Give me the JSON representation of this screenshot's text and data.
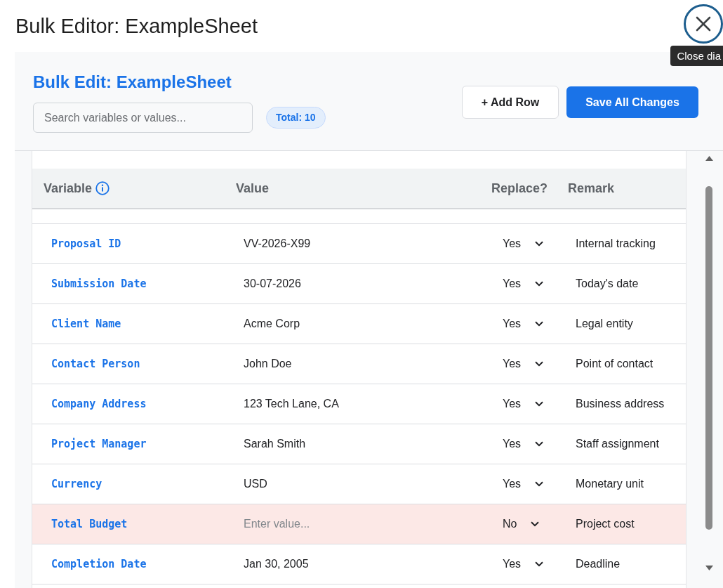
{
  "dialog": {
    "title": "Bulk Editor: ExampleSheet",
    "close_tooltip": "Close dia"
  },
  "panel": {
    "heading": "Bulk Edit: ExampleSheet",
    "search": {
      "placeholder": "Search variables or values..."
    },
    "total_badge": "Total: 10",
    "buttons": [
      {
        "label": "+ Add Row",
        "kind": "secondary"
      },
      {
        "label": "Save All Changes",
        "kind": "primary"
      }
    ]
  },
  "table": {
    "columns": [
      {
        "label": "Variable",
        "kind": "info"
      },
      {
        "label": "Value",
        "kind": "plain"
      },
      {
        "label": "Replace?",
        "kind": "plain"
      },
      {
        "label": "Remark",
        "kind": "plain"
      }
    ],
    "rows": [
      {
        "variable": "Proposal ID",
        "value": "VV-2026-X99",
        "replace": "Yes",
        "remark": "Internal tracking",
        "error": false
      },
      {
        "variable": "Submission Date",
        "value": "30-07-2026",
        "replace": "Yes",
        "remark": "Today's date",
        "error": false
      },
      {
        "variable": "Client Name",
        "value": "Acme Corp",
        "replace": "Yes",
        "remark": "Legal entity",
        "error": false
      },
      {
        "variable": "Contact Person",
        "value": "John Doe",
        "replace": "Yes",
        "remark": "Point of contact",
        "error": false
      },
      {
        "variable": "Company Address",
        "value": "123 Tech Lane, CA",
        "replace": "Yes",
        "remark": "Business address",
        "error": false
      },
      {
        "variable": "Project Manager",
        "value": "Sarah Smith",
        "replace": "Yes",
        "remark": "Staff assignment",
        "error": false
      },
      {
        "variable": "Currency",
        "value": "USD",
        "replace": "Yes",
        "remark": "Monetary unit",
        "error": false
      },
      {
        "variable": "Total Budget",
        "placeholder": "Enter value...",
        "replace": "No",
        "remark": "Project cost",
        "error": true
      },
      {
        "variable": "Completion Date",
        "value": "Jan 30, 2005",
        "replace": "Yes",
        "remark": "Deadline",
        "error": false
      }
    ]
  }
}
